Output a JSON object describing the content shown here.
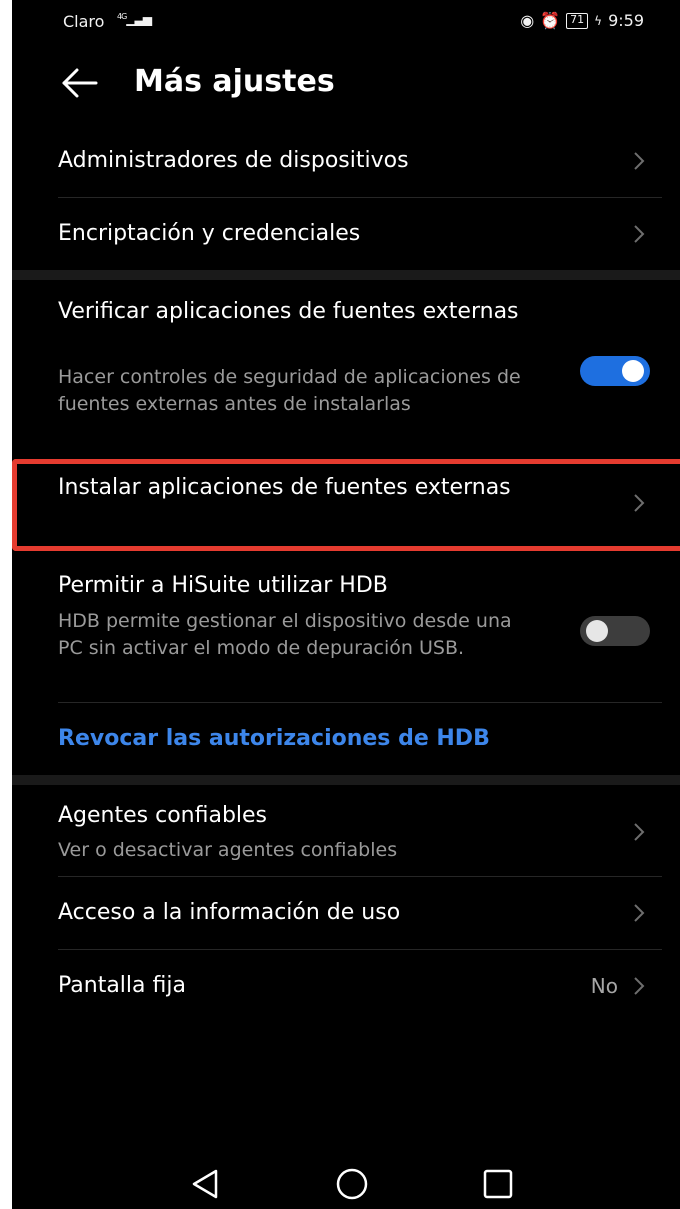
{
  "status_bar": {
    "carrier": "Claro",
    "network": "4G",
    "battery": "71",
    "time": "9:59"
  },
  "header": {
    "back_icon": "arrow-left-icon",
    "title": "Más ajustes"
  },
  "rows": {
    "device_admins": {
      "title": "Administradores de dispositivos"
    },
    "encryption": {
      "title": "Encriptación y credenciales"
    },
    "verify_apps": {
      "title": "Verificar aplicaciones de fuentes externas",
      "subtitle": "Hacer controles de seguridad de aplicaciones de fuentes externas antes de instalarlas",
      "toggle_on": true
    },
    "install_external": {
      "title": "Instalar aplicaciones de fuentes externas"
    },
    "hisuite_hdb": {
      "title": "Permitir a HiSuite utilizar HDB",
      "subtitle": "HDB permite gestionar el dispositivo desde una PC sin activar el modo de depuración USB.",
      "toggle_on": false
    },
    "revoke_hdb": {
      "label": "Revocar las autorizaciones de HDB"
    },
    "trust_agents": {
      "title": "Agentes confiables",
      "subtitle": "Ver o desactivar agentes confiables"
    },
    "usage_access": {
      "title": "Acceso a la información de uso"
    },
    "screen_pinning": {
      "title": "Pantalla fija",
      "value": "No"
    }
  },
  "nav": {
    "back": "triangle-back-icon",
    "home": "circle-home-icon",
    "recents": "square-recents-icon"
  },
  "colors": {
    "background": "#000000",
    "accent": "#1e6fe0",
    "link": "#3d86ea",
    "highlight": "#e53b2f"
  }
}
